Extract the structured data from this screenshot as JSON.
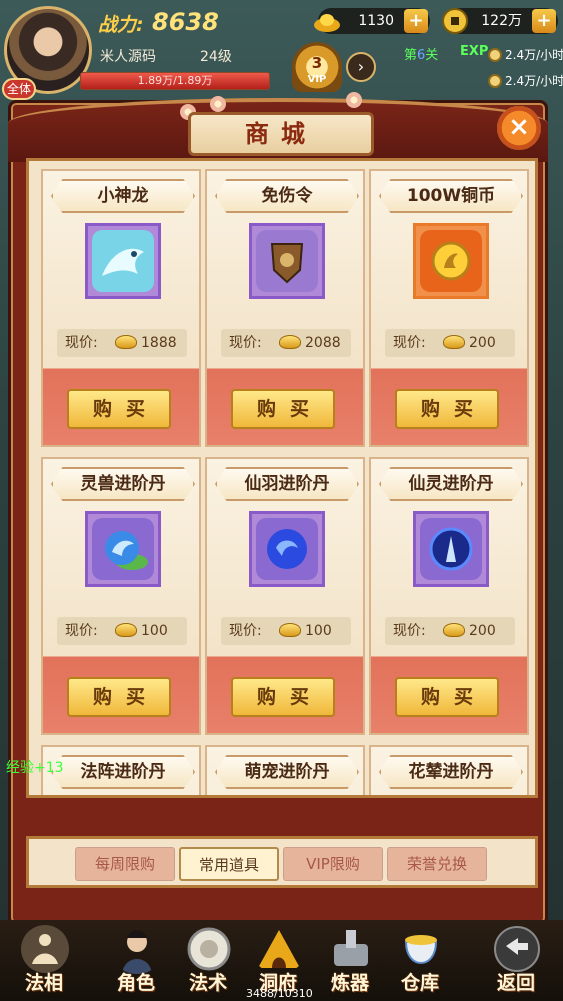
{
  "hud": {
    "power_label": "战力:",
    "power_value": "8638",
    "avatar_badge": "全体",
    "player_name": "米人源码",
    "player_level": "24级",
    "hp_text": "1.89万/1.89万",
    "hp_ratio": 1.0,
    "vip_level": "3",
    "vip_label": "VIP",
    "gold_ingot": "1130",
    "coins": "122万",
    "stage_prefix": "第",
    "stage_number": "6",
    "stage_suffix": "关",
    "exp_label": "EXP",
    "exp_rate": "2.4万/小时",
    "coin_rate": "2.4万/小时"
  },
  "shop": {
    "title": "商城",
    "price_label": "现价:",
    "buy_label": "购买",
    "items": [
      {
        "name": "小神龙",
        "price": "1888",
        "icon": "blue-dragon-icon"
      },
      {
        "name": "免伤令",
        "price": "2088",
        "icon": "shield-token-icon"
      },
      {
        "name": "100W铜币",
        "price": "200",
        "icon": "gold-coin-icon"
      },
      {
        "name": "灵兽进阶丹",
        "price": "100",
        "icon": "spirit-beast-pill-icon"
      },
      {
        "name": "仙羽进阶丹",
        "price": "100",
        "icon": "feather-pill-icon"
      },
      {
        "name": "仙灵进阶丹",
        "price": "200",
        "icon": "fairy-spirit-pill-icon"
      },
      {
        "name": "法阵进阶丹",
        "price": "",
        "icon": ""
      },
      {
        "name": "萌宠进阶丹",
        "price": "",
        "icon": ""
      },
      {
        "name": "花辇进阶丹",
        "price": "",
        "icon": ""
      }
    ],
    "tabs": [
      "每周限购",
      "常用道具",
      "VIP限购",
      "荣誉兑换"
    ],
    "active_tab": "常用道具"
  },
  "side": {
    "exp_text": "经验+13"
  },
  "nav": {
    "items": [
      "法相",
      "角色",
      "法术",
      "洞府",
      "炼器",
      "仓库",
      "返回"
    ],
    "counter": "3488/10310"
  }
}
